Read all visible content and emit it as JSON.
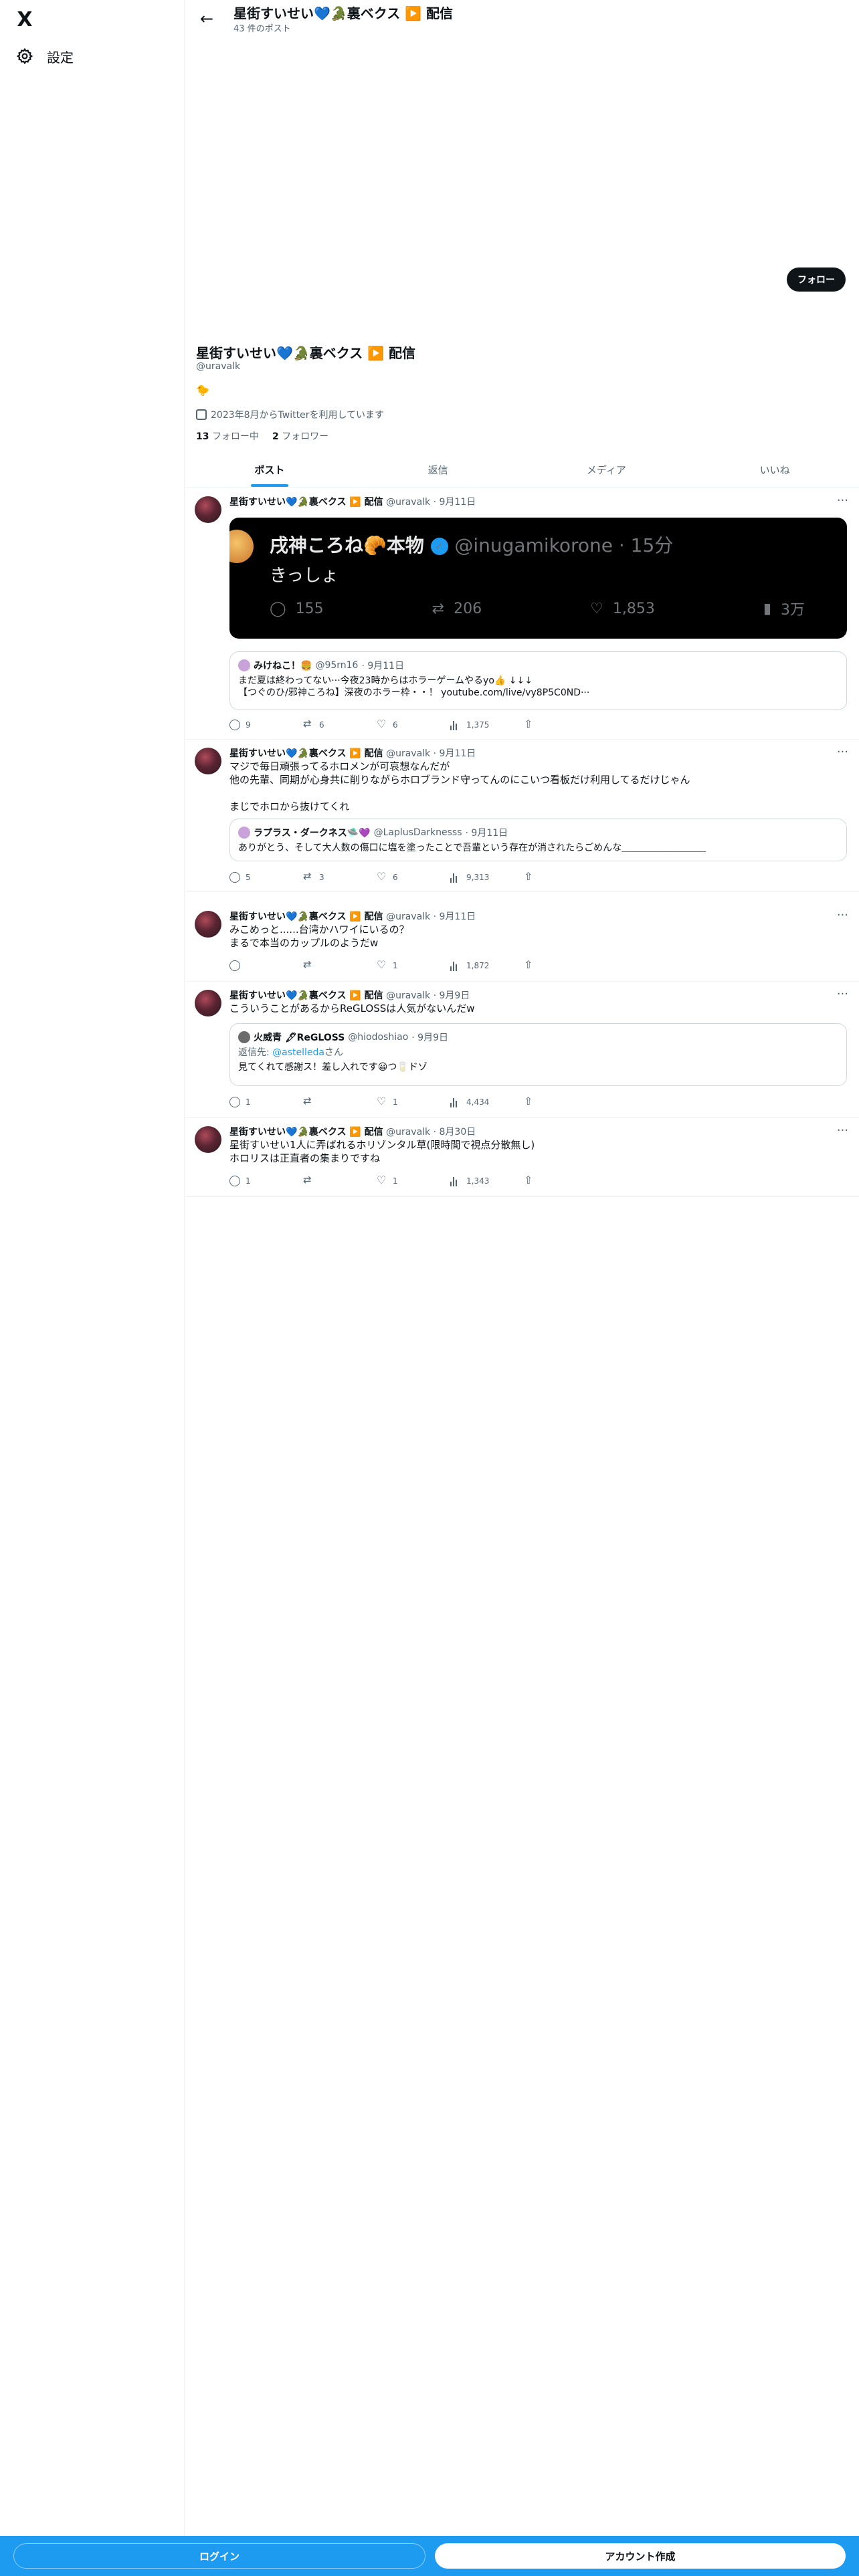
{
  "app": {
    "logo": "X",
    "logo_icon": "x-logo-icon"
  },
  "sidebar": {
    "settings_label": "設定",
    "settings_icon": "gear-icon"
  },
  "header": {
    "title": "星街すいせい💙🐊裏ベクス ▶️ 配信",
    "post_count": "43 件のポスト",
    "back_icon": "arrow-left-icon"
  },
  "profile": {
    "follow_label": "フォロー",
    "name": "星街すいせい💙🐊裏ベクス ▶️ 配信",
    "handle": "@uravalk",
    "bio": "🐤",
    "joined": "2023年8月からTwitterを利用しています",
    "following_count": "13",
    "following_label": "フォロー中",
    "followers_count": "2",
    "followers_label": "フォロワー"
  },
  "tabs": [
    {
      "label": "ポスト",
      "active": true
    },
    {
      "label": "返信",
      "active": false
    },
    {
      "label": "メディア",
      "active": false
    },
    {
      "label": "いいね",
      "active": false
    }
  ],
  "tweets": [
    {
      "name": "星街すいせい💙🐊裏ベクス ▶️ 配信",
      "handle": "@uravalk",
      "date": "· 9月11日",
      "media": {
        "name": "戌神ころね🥐本物",
        "handle": "@inugamikorone · 15分",
        "text": "きっしょ",
        "replies": "155",
        "retweets": "206",
        "likes": "1,853",
        "views": "3万"
      },
      "quote": {
        "name": "みけねこ！🍔",
        "handle": "@95rn16",
        "date": "· 9月11日",
        "text": "まだ夏は終わってない···今夜23時からはホラーゲームやるyo👍 ↓↓↓\n【つぐのひ/邪神ころね】深夜のホラー枠・・！ youtube.com/live/vy8P5C0ND···"
      },
      "replies": "9",
      "retweets": "6",
      "likes": "6",
      "views": "1,375"
    },
    {
      "name": "星街すいせい💙🐊裏ベクス ▶️ 配信",
      "handle": "@uravalk",
      "date": "· 9月11日",
      "text": "マジで毎日頑張ってるホロメンが可哀想なんだが\n他の先輩、同期が心身共に削りながらホロブランド守ってんのにこいつ看板だけ利用してるだけじゃん\n\nまじでホロから抜けてくれ",
      "quote": {
        "name": "ラプラス・ダークネス🛸💜",
        "handle": "@LaplusDarknesss",
        "date": "· 9月11日",
        "text": "ありがとう、そして大人数の傷口に塩を塗ったことで吾輩という存在が消されたらごめんな＿＿＿＿＿＿＿＿＿"
      },
      "replies": "5",
      "retweets": "3",
      "likes": "6",
      "views": "9,313"
    },
    {
      "name": "星街すいせい💙🐊裏ベクス ▶️ 配信",
      "handle": "@uravalk",
      "date": "· 9月11日",
      "text": "みこめっと......台湾かハワイにいるの？\nまるで本当のカップルのようだw",
      "replies": "",
      "retweets": "",
      "likes": "1",
      "views": "1,872"
    },
    {
      "name": "星街すいせい💙🐊裏ベクス ▶️ 配信",
      "handle": "@uravalk",
      "date": "· 9月9日",
      "text": "こういうことがあるからReGLOSSは人気がないんだw",
      "quote": {
        "name": "火威青 🖋ReGLOSS",
        "handle": "@hiodoshiao",
        "date": "· 9月9日",
        "reply_label": "返信先:",
        "reply_to": "@astelleda",
        "reply_suffix": "さん",
        "text": "見てくれて感謝ス！差し入れです😀つ🥛ドゾ"
      },
      "replies": "1",
      "retweets": "",
      "likes": "1",
      "views": "4,434"
    },
    {
      "name": "星街すいせい💙🐊裏ベクス ▶️ 配信",
      "handle": "@uravalk",
      "date": "· 8月30日",
      "text": "星街すいせい1人に弄ばれるホリゾンタル草(限時間で視点分散無し)\nホロリスは正直者の集まりですね",
      "replies": "1",
      "retweets": "",
      "likes": "1",
      "views": "1,343"
    }
  ],
  "footer": {
    "login_label": "ログイン",
    "signup_label": "アカウント作成"
  },
  "colors": {
    "accent": "#1d9bf0",
    "text": "#0f1419",
    "muted": "#536471",
    "border": "#eff3f4"
  }
}
